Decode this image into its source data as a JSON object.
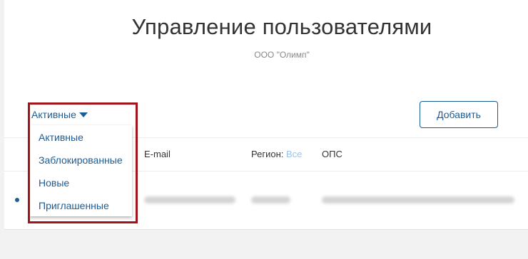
{
  "header": {
    "title": "Управление пользователями",
    "organization": "ООО \"Олимп\""
  },
  "filter": {
    "selected": "Активные",
    "options": [
      "Активные",
      "Заблокированные",
      "Новые",
      "Приглашенные"
    ]
  },
  "toolbar": {
    "add_label": "Добавить"
  },
  "table": {
    "columns": {
      "email": "E-mail",
      "region_label": "Регион:",
      "region_value": "Все",
      "ops": "ОПС"
    }
  },
  "colors": {
    "accent": "#1a5c96",
    "highlight": "#a11419"
  }
}
